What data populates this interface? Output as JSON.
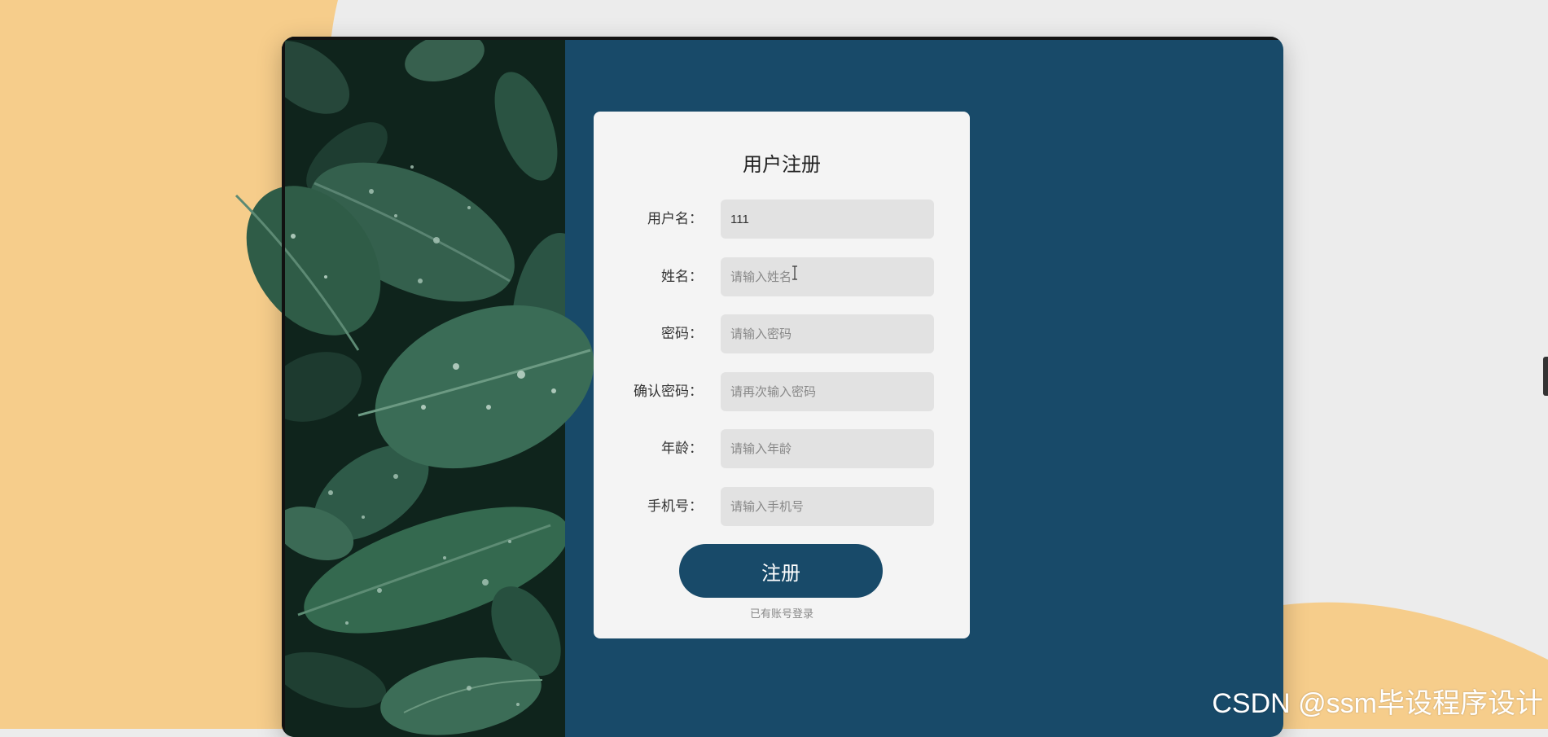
{
  "form": {
    "title": "用户注册",
    "fields": [
      {
        "label": "用户名：",
        "value": "111",
        "placeholder": ""
      },
      {
        "label": "姓名：",
        "value": "",
        "placeholder": "请输入姓名"
      },
      {
        "label": "密码：",
        "value": "",
        "placeholder": "请输入密码"
      },
      {
        "label": "确认密码：",
        "value": "",
        "placeholder": "请再次输入密码"
      },
      {
        "label": "年龄：",
        "value": "",
        "placeholder": "请输入年龄"
      },
      {
        "label": "手机号：",
        "value": "",
        "placeholder": "请输入手机号"
      }
    ],
    "submit_label": "注册",
    "login_link": "已有账号登录"
  },
  "watermark": "CSDN @ssm毕设程序设计",
  "colors": {
    "card_bg": "#184a69",
    "form_bg": "#f4f4f4",
    "input_bg": "#e2e2e2",
    "accent_peach": "#f6cd8b",
    "page_bg": "#ececec"
  }
}
